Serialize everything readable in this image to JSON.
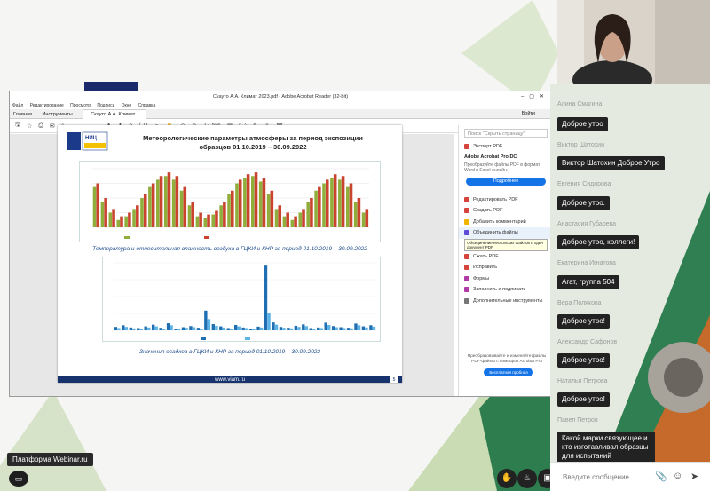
{
  "platform_label": "Платформа Webinar.ru",
  "acrobat": {
    "title": "Скауто А.А. Климат 2023.pdf - Adobe Acrobat Reader (32-bit)",
    "menu": [
      "Файл",
      "Редактирование",
      "Просмотр",
      "Подпись",
      "Окно",
      "Справка"
    ],
    "tabs": {
      "home": "Главная",
      "tools": "Инструменты",
      "doc": "Скауто А.А. Климат...",
      "signin": "Войти"
    },
    "toolbar": {
      "page": "5",
      "of": "/ 11",
      "zoom": "77,5%"
    },
    "slide": {
      "title_line1": "Метеорологические параметры атмосферы за период экспозиции",
      "title_line2": "образцов 01.10.2019 – 30.09.2022",
      "logo_text": "НИЦ",
      "caption1": "Температура и относительная влажность воздуха в ГЦКИ и КНР за период 01.10.2019 – 30.09.2022",
      "caption2": "Значения осадков в ГЦКИ и КНР за период 01.10.2019 – 30.09.2022",
      "footer": "www.viam.ru",
      "page_number": "5"
    },
    "right_pane": {
      "search": "Поиск \"Скрыть страницу\"",
      "export_title": "Экспорт PDF",
      "product": "Adobe Acrobat Pro DC",
      "promo": "Преобразуйте файлы PDF в формат Word и Excel онлайн.",
      "more_btn": "Подробнее",
      "items": [
        "Редактировать PDF",
        "Создать PDF",
        "Добавить комментарий",
        "Объединить файлы",
        "Сжать PDF",
        "Исправить",
        "Формы",
        "Заполнить и подписать",
        "Дополнительные инструменты"
      ],
      "tooltip": "Объединение нескольких файлов в один документ PDF",
      "footer_text": "Преобразовывайте и изменяйте файлы PDF-файлы с помощью Acrobat Pro",
      "trial_btn": "Бесплатная пробная версия"
    }
  },
  "chat": {
    "messages": [
      {
        "name": "Алина Смагина",
        "text": "Доброе утро"
      },
      {
        "name": "Виктор Шатохин",
        "text": "Виктор Шатохин Доброе Утро"
      },
      {
        "name": "Евгения Сидорова",
        "text": "Доброе утро."
      },
      {
        "name": "Анастасия Губарева",
        "text": "Доброе утро, коллеги!"
      },
      {
        "name": "Екатерина Игнатова",
        "text": "Агат, группа 504"
      },
      {
        "name": "Вера Полякова",
        "text": "Доброе утро!"
      },
      {
        "name": "Александр Сафонов",
        "text": "Доброе утро!"
      },
      {
        "name": "Наталья Петрова",
        "text": "Доброе утро!"
      },
      {
        "name": "Павел Петров",
        "text": "Какой марки связующее и кто изготавливал образцы для испытаний"
      }
    ],
    "input_placeholder": "Введите сообщение"
  },
  "chart_data": [
    {
      "type": "bar",
      "title": "",
      "series": [
        {
          "name": "ГЦКИ Температура",
          "values": [
            22,
            14,
            8,
            4,
            6,
            10,
            16,
            22,
            26,
            28,
            26,
            20,
            12,
            6,
            5,
            7,
            12,
            18,
            24,
            27,
            28,
            25,
            18,
            10,
            6,
            4,
            8,
            14,
            20,
            24,
            27,
            26,
            22,
            14,
            8
          ]
        },
        {
          "name": "КНР Температура",
          "values": [
            24,
            16,
            10,
            6,
            8,
            12,
            18,
            24,
            28,
            30,
            28,
            22,
            14,
            8,
            7,
            9,
            14,
            20,
            26,
            29,
            30,
            27,
            20,
            12,
            8,
            6,
            10,
            16,
            22,
            26,
            29,
            28,
            24,
            16,
            10
          ]
        }
      ]
    },
    {
      "type": "bar",
      "title": "",
      "series": [
        {
          "name": "ГЦКИ осадки",
          "values": [
            12,
            18,
            10,
            8,
            14,
            20,
            9,
            25,
            6,
            11,
            15,
            9,
            70,
            22,
            14,
            8,
            19,
            10,
            6,
            13,
            230,
            28,
            12,
            9,
            16,
            21,
            8,
            10,
            27,
            15,
            11,
            9,
            24,
            14,
            18
          ]
        },
        {
          "name": "КНР осадки",
          "values": [
            8,
            12,
            7,
            5,
            10,
            14,
            6,
            18,
            4,
            9,
            11,
            6,
            40,
            16,
            10,
            6,
            14,
            8,
            4,
            10,
            60,
            20,
            9,
            7,
            12,
            15,
            6,
            8,
            19,
            11,
            8,
            7,
            18,
            10,
            13
          ]
        }
      ]
    }
  ]
}
